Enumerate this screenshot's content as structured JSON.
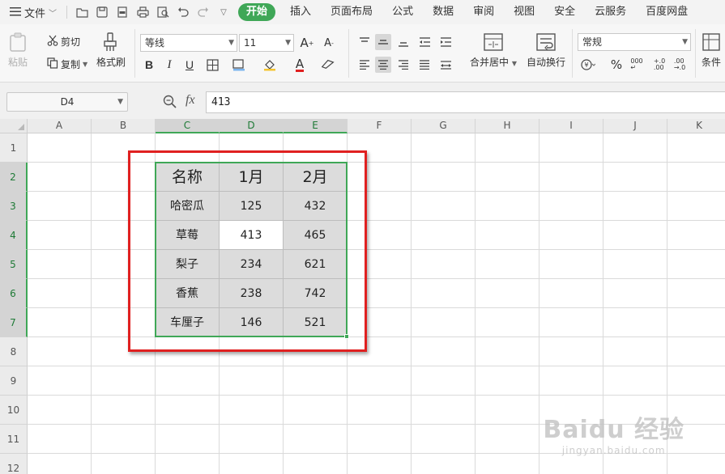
{
  "menu": {
    "file_label": "文件",
    "tabs": [
      "开始",
      "插入",
      "页面布局",
      "公式",
      "数据",
      "审阅",
      "视图",
      "安全",
      "云服务",
      "百度网盘"
    ],
    "active_tab": "开始",
    "accent_color": "#3fa757"
  },
  "ribbon": {
    "paste_label": "粘贴",
    "cut_label": "剪切",
    "copy_label": "复制",
    "format_painter_label": "格式刷",
    "font_name": "等线",
    "font_size": "11",
    "bold": "B",
    "italic": "I",
    "underline": "U",
    "merge_center_label": "合并居中",
    "wrap_text_label": "自动换行",
    "number_format": "常规",
    "conditional_label": "条件"
  },
  "formula_bar": {
    "name_box": "D4",
    "fx": "fx",
    "value": "413"
  },
  "sheet": {
    "columns": [
      "A",
      "B",
      "C",
      "D",
      "E",
      "F",
      "G",
      "H",
      "I",
      "J",
      "K"
    ],
    "rows": [
      "1",
      "2",
      "3",
      "4",
      "5",
      "6",
      "7",
      "8",
      "9",
      "10",
      "11",
      "12"
    ],
    "table": [
      [
        "名称",
        "1月",
        "2月"
      ],
      [
        "哈密瓜",
        "125",
        "432"
      ],
      [
        "草莓",
        "413",
        "465"
      ],
      [
        "梨子",
        "234",
        "621"
      ],
      [
        "香蕉",
        "238",
        "742"
      ],
      [
        "车厘子",
        "146",
        "521"
      ]
    ]
  },
  "watermark": {
    "brand": "Baidu 经验",
    "site": "jingyan.baidu.com"
  }
}
